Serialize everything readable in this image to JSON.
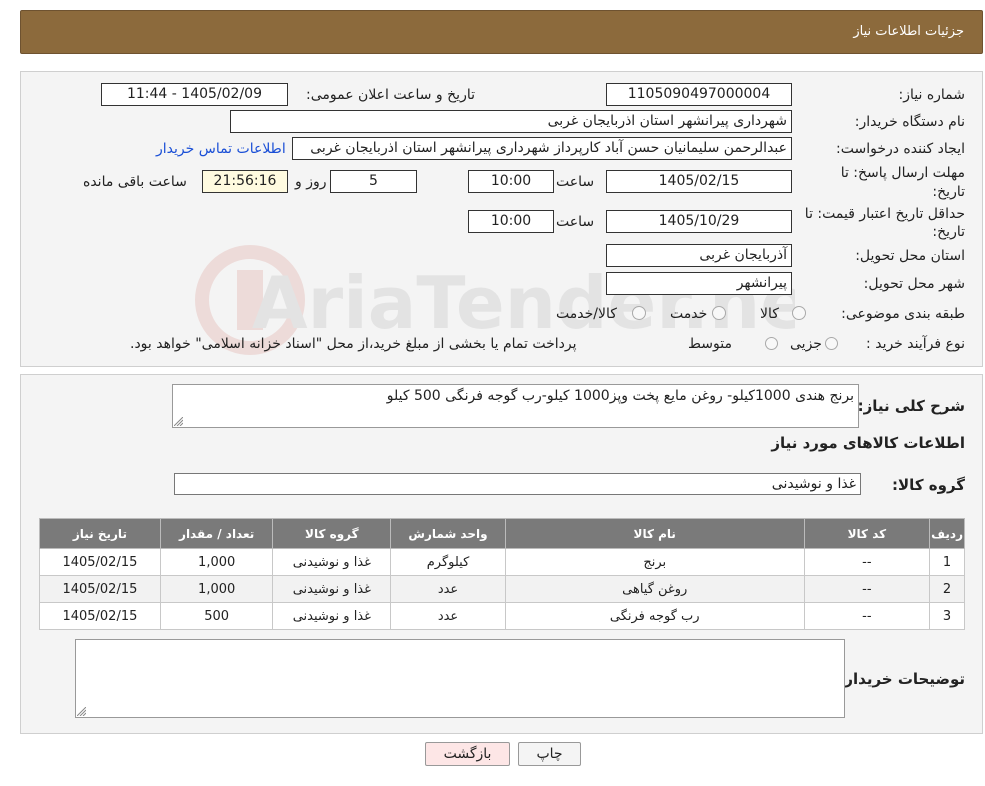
{
  "header": {
    "title": "جزئیات اطلاعات نیاز"
  },
  "form": {
    "need_number_label": "شماره نیاز:",
    "need_number": "1105090497000004",
    "announce_label": "تاریخ و ساعت اعلان عمومی:",
    "announce_value": "1405/02/09 - 11:44",
    "buyer_org_label": "نام دستگاه خریدار:",
    "buyer_org": "شهرداری پیرانشهر استان اذربایجان غربی",
    "creator_label": "ایجاد کننده درخواست:",
    "creator": "عبدالرحمن سلیمانیان حسن آباد کارپرداز شهرداری پیرانشهر استان اذربایجان غربی",
    "contact_link": "اطلاعات تماس خریدار",
    "deadline_label_1": "مهلت ارسال پاسخ: تا",
    "deadline_label_2": "تاریخ:",
    "deadline_date": "1405/02/15",
    "time_label": "ساعت",
    "deadline_time": "10:00",
    "days_value": "5",
    "days_label": "روز و",
    "remaining_time": "21:56:16",
    "remaining_label": "ساعت باقی مانده",
    "validity_label_1": "حداقل تاریخ اعتبار قیمت: تا",
    "validity_label_2": "تاریخ:",
    "validity_date": "1405/10/29",
    "validity_time": "10:00",
    "province_label": "استان محل تحویل:",
    "province": "آذربایجان غربی",
    "city_label": "شهر محل تحویل:",
    "city": "پیرانشهر",
    "category_label": "طبقه بندی موضوعی:",
    "category_options": [
      "کالا",
      "خدمت",
      "کالا/خدمت"
    ],
    "process_label": "نوع فرآیند خرید :",
    "process_options": [
      "جزیی",
      "متوسط"
    ],
    "process_note": "پرداخت تمام یا بخشی از مبلغ خرید،از محل \"اسناد خزانه اسلامی\" خواهد بود."
  },
  "details": {
    "summary_label": "شرح کلی نیاز:",
    "summary": "برنج هندی 1000کیلو- روغن مایع پخت وپز1000 کیلو-رب گوجه فرنگی 500 کیلو",
    "goods_info_title": "اطلاعات کالاهای مورد نیاز",
    "goods_group_label": "گروه کالا:",
    "goods_group": "غذا و نوشیدنی",
    "table": {
      "headers": [
        "ردیف",
        "کد کالا",
        "نام کالا",
        "واحد شمارش",
        "گروه کالا",
        "تعداد / مقدار",
        "تاریخ نیاز"
      ],
      "rows": [
        [
          "1",
          "--",
          "برنج",
          "کیلوگرم",
          "غذا و نوشیدنی",
          "1,000",
          "1405/02/15"
        ],
        [
          "2",
          "--",
          "روغن گیاهی",
          "عدد",
          "غذا و نوشیدنی",
          "1,000",
          "1405/02/15"
        ],
        [
          "3",
          "--",
          "رب گوجه فرنگی",
          "عدد",
          "غذا و نوشیدنی",
          "500",
          "1405/02/15"
        ]
      ]
    },
    "buyer_notes_label": "توضیحات خریدار:",
    "buyer_notes": ""
  },
  "buttons": {
    "print": "چاپ",
    "back": "بازگشت"
  },
  "watermark": "AriaTender.neT",
  "colors": {
    "header_bg": "#8c6a3c",
    "table_header_bg": "#7a7a7a",
    "link": "#1a4fd6",
    "back_button_bg": "#fde6e6"
  }
}
